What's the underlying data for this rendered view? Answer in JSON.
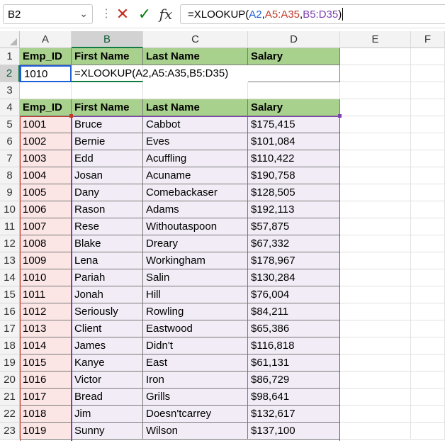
{
  "formula_bar": {
    "name_box": "B2",
    "formula_prefix": "=XLOOKUP(",
    "arg1": "A2",
    "sep1": ",",
    "arg2": "A5:A35",
    "sep2": ",",
    "arg3": "B5:D35",
    "formula_suffix": ")",
    "arg1_color": "#1f5fd6",
    "arg2_color": "#c0392b",
    "arg3_color": "#7b3fb0"
  },
  "columns": [
    "A",
    "B",
    "C",
    "D",
    "E",
    "F"
  ],
  "row_numbers": [
    "1",
    "2",
    "3",
    "4",
    "5",
    "6",
    "7",
    "8",
    "9",
    "10",
    "11",
    "12",
    "13",
    "14",
    "15",
    "16",
    "17",
    "18",
    "19",
    "20",
    "21",
    "22",
    "23"
  ],
  "lookup_header": {
    "a": "Emp_ID",
    "b": "First Name",
    "c": "Last Name",
    "d": "Salary"
  },
  "lookup_row": {
    "a": "1010",
    "b": "=XLOOKUP(A2,A5:A35,B5:D35)",
    "d": ""
  },
  "table_header": {
    "a": "Emp_ID",
    "b": "First Name",
    "c": "Last Name",
    "d": "Salary"
  },
  "rows": [
    {
      "id": "1001",
      "first": "Bruce",
      "last": "Cabbot",
      "salary": "$175,415"
    },
    {
      "id": "1002",
      "first": "Bernie",
      "last": "Eves",
      "salary": "$101,084"
    },
    {
      "id": "1003",
      "first": "Edd",
      "last": "Acuffling",
      "salary": "$110,422"
    },
    {
      "id": "1004",
      "first": "Josan",
      "last": "Acuname",
      "salary": "$190,758"
    },
    {
      "id": "1005",
      "first": "Dany",
      "last": "Comebackaser",
      "salary": "$128,505"
    },
    {
      "id": "1006",
      "first": "Rason",
      "last": "Adams",
      "salary": "$192,113"
    },
    {
      "id": "1007",
      "first": "Rese",
      "last": "Withoutaspoon",
      "salary": "$57,875"
    },
    {
      "id": "1008",
      "first": "Blake",
      "last": "Dreary",
      "salary": "$67,332"
    },
    {
      "id": "1009",
      "first": "Lena",
      "last": "Workingham",
      "salary": "$178,967"
    },
    {
      "id": "1010",
      "first": "Pariah",
      "last": "Salin",
      "salary": "$130,284"
    },
    {
      "id": "1011",
      "first": "Jonah",
      "last": "Hill",
      "salary": "$76,004"
    },
    {
      "id": "1012",
      "first": "Seriously",
      "last": "Rowling",
      "salary": "$84,211"
    },
    {
      "id": "1013",
      "first": "Client",
      "last": "Eastwood",
      "salary": "$65,386"
    },
    {
      "id": "1014",
      "first": "James",
      "last": "Didn't",
      "salary": "$116,818"
    },
    {
      "id": "1015",
      "first": "Kanye",
      "last": "East",
      "salary": "$61,131"
    },
    {
      "id": "1016",
      "first": "Victor",
      "last": "Iron",
      "salary": "$86,729"
    },
    {
      "id": "1017",
      "first": "Bread",
      "last": "Grills",
      "salary": "$98,641"
    },
    {
      "id": "1018",
      "first": "Jim",
      "last": "Doesn'tcarrey",
      "salary": "$132,617"
    },
    {
      "id": "1019",
      "first": "Sunny",
      "last": "Wilson",
      "salary": "$137,100"
    }
  ],
  "icons": {
    "cancel": "cancel-x-icon",
    "enter": "enter-check-icon",
    "function": "insert-function-icon",
    "dropdown": "chevron-down-icon",
    "more": "more-vertical-icon"
  },
  "colors": {
    "header_fill": "#a9d18e",
    "id_tint": "#fbe5e5",
    "data_tint": "#f1ecf5",
    "selection_green": "#107c41"
  }
}
